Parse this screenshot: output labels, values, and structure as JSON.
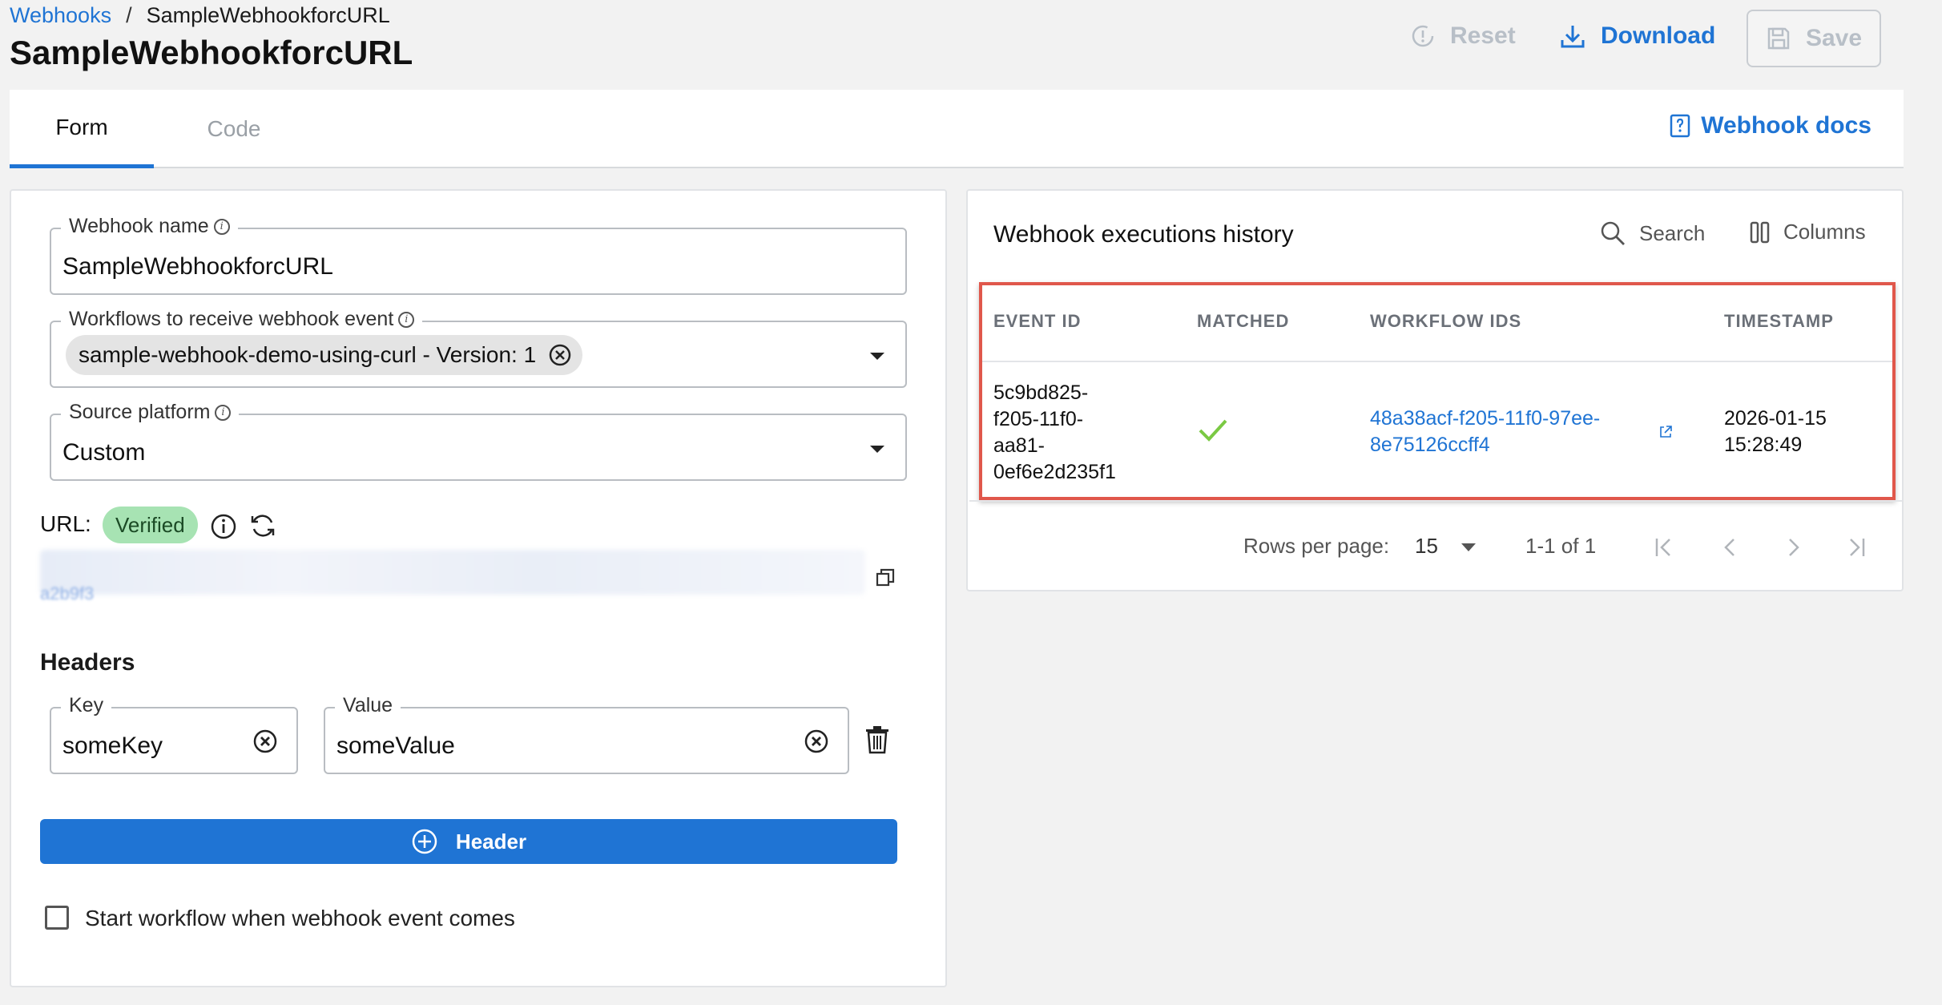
{
  "breadcrumb": {
    "parent": "Webhooks",
    "separator": "/",
    "current": "SampleWebhookforcURL"
  },
  "page_title": "SampleWebhookforcURL",
  "actions": {
    "reset": "Reset",
    "download": "Download",
    "save": "Save"
  },
  "tabs": [
    {
      "label": "Form",
      "active": true
    },
    {
      "label": "Code",
      "active": false
    }
  ],
  "docs_link": "Webhook docs",
  "form": {
    "webhook_name": {
      "label": "Webhook name",
      "value": "SampleWebhookforcURL"
    },
    "workflows": {
      "label": "Workflows to receive webhook event",
      "chip": "sample-webhook-demo-using-curl - Version: 1"
    },
    "source_platform": {
      "label": "Source platform",
      "value": "Custom"
    },
    "url": {
      "label": "URL:",
      "status": "Verified",
      "tail": "a2b9f3"
    },
    "headers_title": "Headers",
    "header_row": {
      "key_label": "Key",
      "key_value": "someKey",
      "value_label": "Value",
      "value_value": "someValue"
    },
    "add_header_button": "Header",
    "start_workflow_checkbox": {
      "label": "Start workflow when webhook event comes",
      "checked": false
    }
  },
  "history": {
    "title": "Webhook executions history",
    "search": "Search",
    "columns": "Columns",
    "table": {
      "headers": [
        "EVENT ID",
        "MATCHED",
        "WORKFLOW IDS",
        "TIMESTAMP"
      ],
      "rows": [
        {
          "event_id_lines": [
            "5c9bd825-",
            "f205-11f0-",
            "aa81-",
            "0ef6e2d235f1"
          ],
          "matched": true,
          "workflow_id_lines": [
            "48a38acf-f205-11f0-97ee-",
            "8e75126ccff4"
          ],
          "timestamp_lines": [
            "2026-01-15",
            "15:28:49"
          ]
        }
      ]
    },
    "pagination": {
      "rows_per_page_label": "Rows per page:",
      "rows_per_page": "15",
      "range": "1-1 of 1"
    }
  },
  "colors": {
    "accent": "#1f74d4",
    "verified_bg": "#a7e3b3",
    "matched_check": "#7ac943",
    "highlight_border": "#e0574b"
  }
}
